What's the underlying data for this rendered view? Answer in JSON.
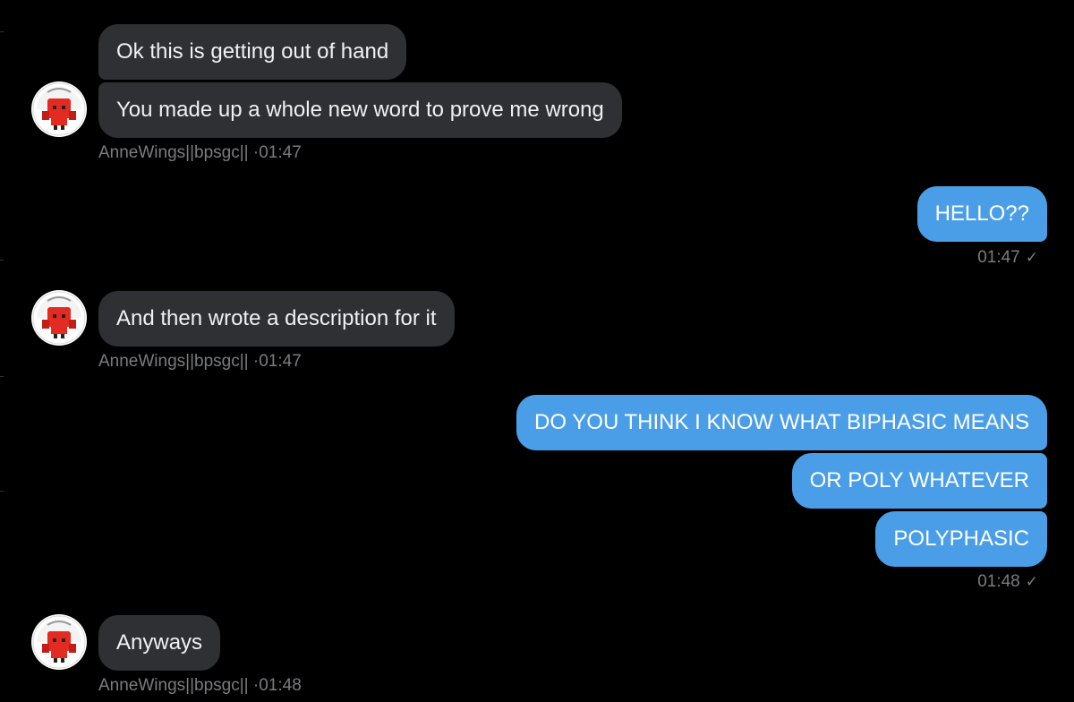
{
  "conversation": {
    "messages": {
      "m1": {
        "text": "Ok this is getting out of hand"
      },
      "m2": {
        "text": "You made up a whole new word to prove me wrong"
      },
      "m3": {
        "text": "HELLO??"
      },
      "m4": {
        "text": "And then wrote a description for it"
      },
      "m5": {
        "text": "DO YOU THINK I KNOW WHAT BIPHASIC MEANS"
      },
      "m6": {
        "text": "OR POLY WHATEVER"
      },
      "m7": {
        "text": "POLYPHASIC"
      },
      "m8": {
        "text": "Anyways"
      }
    },
    "meta": {
      "g1": {
        "sender": "AnneWings||bpsgc||",
        "time": "01:47"
      },
      "g2": {
        "time": "01:47"
      },
      "g3": {
        "sender": "AnneWings||bpsgc||",
        "time": "01:47"
      },
      "g4": {
        "time": "01:48"
      },
      "g5": {
        "sender": "AnneWings||bpsgc||",
        "time": "01:48"
      }
    },
    "separator": "·",
    "read_mark": "✓"
  },
  "colors": {
    "background": "#000000",
    "incoming_bubble": "#2f3033",
    "outgoing_bubble": "#4a9ee8",
    "meta_text": "#7b7c80"
  },
  "icons": {
    "avatar": "red-robot-avatar-icon",
    "read": "checkmark-icon"
  }
}
